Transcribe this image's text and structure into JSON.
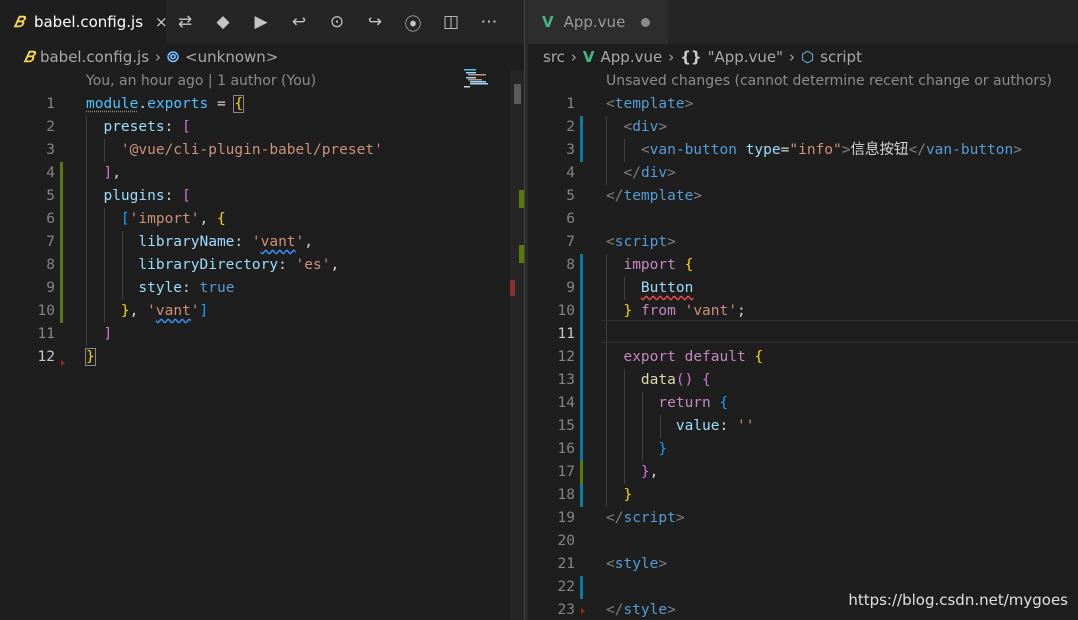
{
  "left": {
    "tab": {
      "label": "babel.config.js",
      "icon": "babel-icon",
      "icon_glyph": "𝐵",
      "close_glyph": "×"
    },
    "actions": [
      {
        "name": "open-changes-icon",
        "glyph": "⇄"
      },
      {
        "name": "git-icon",
        "glyph": "◆"
      },
      {
        "name": "run-icon",
        "glyph": "▶"
      },
      {
        "name": "previous-change-icon",
        "glyph": "↩"
      },
      {
        "name": "commit-icon",
        "glyph": "⊙"
      },
      {
        "name": "next-change-icon",
        "glyph": "↪"
      },
      {
        "name": "timeline-icon",
        "glyph": "⦿"
      },
      {
        "name": "split-editor-icon",
        "glyph": "◫"
      },
      {
        "name": "more-actions-icon",
        "glyph": "⋯"
      }
    ],
    "breadcrumb": [
      {
        "label": "babel.config.js",
        "icon": "babel-icon",
        "glyph": "𝐵"
      },
      {
        "label": "<unknown>",
        "icon": "symbol-variable-icon",
        "glyph": "⦾"
      }
    ],
    "blame": "You, an hour ago | 1 author (You)",
    "lines": [
      {
        "n": "1",
        "mark": ""
      },
      {
        "n": "2",
        "mark": ""
      },
      {
        "n": "3",
        "mark": ""
      },
      {
        "n": "4",
        "mark": "green"
      },
      {
        "n": "5",
        "mark": "green"
      },
      {
        "n": "6",
        "mark": "green"
      },
      {
        "n": "7",
        "mark": "green"
      },
      {
        "n": "8",
        "mark": "green"
      },
      {
        "n": "9",
        "mark": "green"
      },
      {
        "n": "10",
        "mark": "green"
      },
      {
        "n": "11",
        "mark": ""
      },
      {
        "n": "12",
        "mark": "",
        "current": true
      }
    ],
    "code": [
      [
        [
          "module",
          "t-var",
          "dots"
        ],
        [
          ".",
          "t-default"
        ],
        [
          "exports",
          "t-var"
        ],
        [
          " = ",
          "t-default"
        ],
        [
          "{",
          "t-b1",
          "bracket-box"
        ]
      ],
      [
        [
          "  presets",
          "t-key"
        ],
        [
          ": ",
          "t-default"
        ],
        [
          "[",
          "t-b2"
        ]
      ],
      [
        [
          "    ",
          "t-default"
        ],
        [
          "'@vue/cli-plugin-babel/preset'",
          "t-str"
        ]
      ],
      [
        [
          "  ",
          "t-default"
        ],
        [
          "]",
          "t-b2"
        ],
        [
          ",",
          "t-default"
        ]
      ],
      [
        [
          "  plugins",
          "t-key"
        ],
        [
          ": ",
          "t-default"
        ],
        [
          "[",
          "t-b2"
        ]
      ],
      [
        [
          "    ",
          "t-default"
        ],
        [
          "[",
          "t-b3"
        ],
        [
          "'import'",
          "t-str"
        ],
        [
          ", ",
          "t-default"
        ],
        [
          "{",
          "t-b1"
        ]
      ],
      [
        [
          "      libraryName",
          "t-key"
        ],
        [
          ": ",
          "t-default"
        ],
        [
          "'",
          "t-str"
        ],
        [
          "vant",
          "t-str",
          "squig"
        ],
        [
          "'",
          "t-str"
        ],
        [
          ",",
          "t-default"
        ]
      ],
      [
        [
          "      libraryDirectory",
          "t-key"
        ],
        [
          ": ",
          "t-default"
        ],
        [
          "'es'",
          "t-str"
        ],
        [
          ",",
          "t-default"
        ]
      ],
      [
        [
          "      style",
          "t-key"
        ],
        [
          ": ",
          "t-default"
        ],
        [
          "true",
          "t-kw"
        ]
      ],
      [
        [
          "    ",
          "t-default"
        ],
        [
          "}",
          "t-b1"
        ],
        [
          ", ",
          "t-default"
        ],
        [
          "'",
          "t-str"
        ],
        [
          "vant",
          "t-str",
          "squig"
        ],
        [
          "'",
          "t-str"
        ],
        [
          "]",
          "t-b3"
        ]
      ],
      [
        [
          "  ",
          "t-default"
        ],
        [
          "]",
          "t-b2"
        ]
      ],
      [
        [
          "}",
          "t-b1",
          "bracket-box"
        ]
      ]
    ]
  },
  "right": {
    "tab": {
      "label": "App.vue",
      "icon": "vue-icon",
      "icon_glyph": "V"
    },
    "breadcrumb": [
      {
        "label": "src",
        "icon": "",
        "glyph": ""
      },
      {
        "label": "App.vue",
        "icon": "vue-icon",
        "glyph": "V"
      },
      {
        "label": "\"App.vue\"",
        "icon": "braces-icon",
        "glyph": "{}"
      },
      {
        "label": "script",
        "icon": "cube-icon",
        "glyph": "⬡"
      }
    ],
    "blame": "Unsaved changes (cannot determine recent change or authors)",
    "lines": [
      {
        "n": "1",
        "mark": ""
      },
      {
        "n": "2",
        "mark": "blue"
      },
      {
        "n": "3",
        "mark": "blue"
      },
      {
        "n": "4",
        "mark": ""
      },
      {
        "n": "5",
        "mark": ""
      },
      {
        "n": "6",
        "mark": ""
      },
      {
        "n": "7",
        "mark": ""
      },
      {
        "n": "8",
        "mark": "blue"
      },
      {
        "n": "9",
        "mark": "blue"
      },
      {
        "n": "10",
        "mark": "blue"
      },
      {
        "n": "11",
        "mark": "blue",
        "current": true
      },
      {
        "n": "12",
        "mark": "blue"
      },
      {
        "n": "13",
        "mark": "blue"
      },
      {
        "n": "14",
        "mark": "blue"
      },
      {
        "n": "15",
        "mark": "blue"
      },
      {
        "n": "16",
        "mark": "blue"
      },
      {
        "n": "17",
        "mark": "green"
      },
      {
        "n": "18",
        "mark": "blue"
      },
      {
        "n": "19",
        "mark": ""
      },
      {
        "n": "20",
        "mark": ""
      },
      {
        "n": "21",
        "mark": ""
      },
      {
        "n": "22",
        "mark": "blue"
      },
      {
        "n": "23",
        "mark": ""
      }
    ],
    "code": [
      [
        [
          "<",
          "t-punc"
        ],
        [
          "template",
          "t-tag"
        ],
        [
          ">",
          "t-punc"
        ]
      ],
      [
        [
          "  ",
          "t-default"
        ],
        [
          "<",
          "t-punc"
        ],
        [
          "div",
          "t-tag"
        ],
        [
          ">",
          "t-punc"
        ]
      ],
      [
        [
          "    ",
          "t-default"
        ],
        [
          "<",
          "t-punc"
        ],
        [
          "van-button",
          "t-tag"
        ],
        [
          " ",
          "t-default"
        ],
        [
          "type",
          "t-key"
        ],
        [
          "=",
          "t-default"
        ],
        [
          "\"info\"",
          "t-str"
        ],
        [
          ">",
          "t-punc"
        ],
        [
          "信息按钮",
          "t-default"
        ],
        [
          "</",
          "t-punc"
        ],
        [
          "van-button",
          "t-tag"
        ],
        [
          ">",
          "t-punc"
        ]
      ],
      [
        [
          "  ",
          "t-default"
        ],
        [
          "</",
          "t-punc"
        ],
        [
          "div",
          "t-tag"
        ],
        [
          ">",
          "t-punc"
        ]
      ],
      [
        [
          "</",
          "t-punc"
        ],
        [
          "template",
          "t-tag"
        ],
        [
          ">",
          "t-punc"
        ]
      ],
      [
        [
          "",
          "t-default"
        ]
      ],
      [
        [
          "<",
          "t-punc"
        ],
        [
          "script",
          "t-tag"
        ],
        [
          ">",
          "t-punc"
        ]
      ],
      [
        [
          "  ",
          "t-default"
        ],
        [
          "import",
          "t-import"
        ],
        [
          " ",
          "t-default"
        ],
        [
          "{",
          "t-b1"
        ]
      ],
      [
        [
          "    ",
          "t-default"
        ],
        [
          "Button",
          "t-key",
          "squig-red"
        ]
      ],
      [
        [
          "  ",
          "t-default"
        ],
        [
          "}",
          "t-b1"
        ],
        [
          " ",
          "t-default"
        ],
        [
          "from",
          "t-import"
        ],
        [
          " ",
          "t-default"
        ],
        [
          "'vant'",
          "t-str"
        ],
        [
          ";",
          "t-default"
        ]
      ],
      [
        [
          "",
          "t-default"
        ]
      ],
      [
        [
          "  ",
          "t-default"
        ],
        [
          "export",
          "t-import"
        ],
        [
          " ",
          "t-default"
        ],
        [
          "default",
          "t-import"
        ],
        [
          " ",
          "t-default"
        ],
        [
          "{",
          "t-b1"
        ]
      ],
      [
        [
          "    ",
          "t-default"
        ],
        [
          "data",
          "t-fn"
        ],
        [
          "()",
          "t-b2"
        ],
        [
          " ",
          "t-default"
        ],
        [
          "{",
          "t-b2"
        ]
      ],
      [
        [
          "      ",
          "t-default"
        ],
        [
          "return",
          "t-import"
        ],
        [
          " ",
          "t-default"
        ],
        [
          "{",
          "t-b3"
        ]
      ],
      [
        [
          "        value",
          "t-key"
        ],
        [
          ": ",
          "t-default"
        ],
        [
          "''",
          "t-str"
        ]
      ],
      [
        [
          "      ",
          "t-default"
        ],
        [
          "}",
          "t-b3"
        ]
      ],
      [
        [
          "    ",
          "t-default"
        ],
        [
          "}",
          "t-b2"
        ],
        [
          ",",
          "t-default"
        ]
      ],
      [
        [
          "  ",
          "t-default"
        ],
        [
          "}",
          "t-b1"
        ]
      ],
      [
        [
          "</",
          "t-punc"
        ],
        [
          "script",
          "t-tag"
        ],
        [
          ">",
          "t-punc"
        ]
      ],
      [
        [
          "",
          "t-default"
        ]
      ],
      [
        [
          "<",
          "t-punc"
        ],
        [
          "style",
          "t-tag"
        ],
        [
          ">",
          "t-punc"
        ]
      ],
      [
        [
          "",
          "t-default"
        ]
      ],
      [
        [
          "</",
          "t-punc"
        ],
        [
          "style",
          "t-tag"
        ],
        [
          ">",
          "t-punc"
        ]
      ]
    ]
  },
  "colors": {
    "mark_green": "#587c0c",
    "mark_blue": "#0c7d9d",
    "babel_icon": "#f5da55",
    "vue_icon": "#41b883",
    "symbol_icon": "#75beff"
  },
  "watermark": "https://blog.csdn.net/mygoes"
}
